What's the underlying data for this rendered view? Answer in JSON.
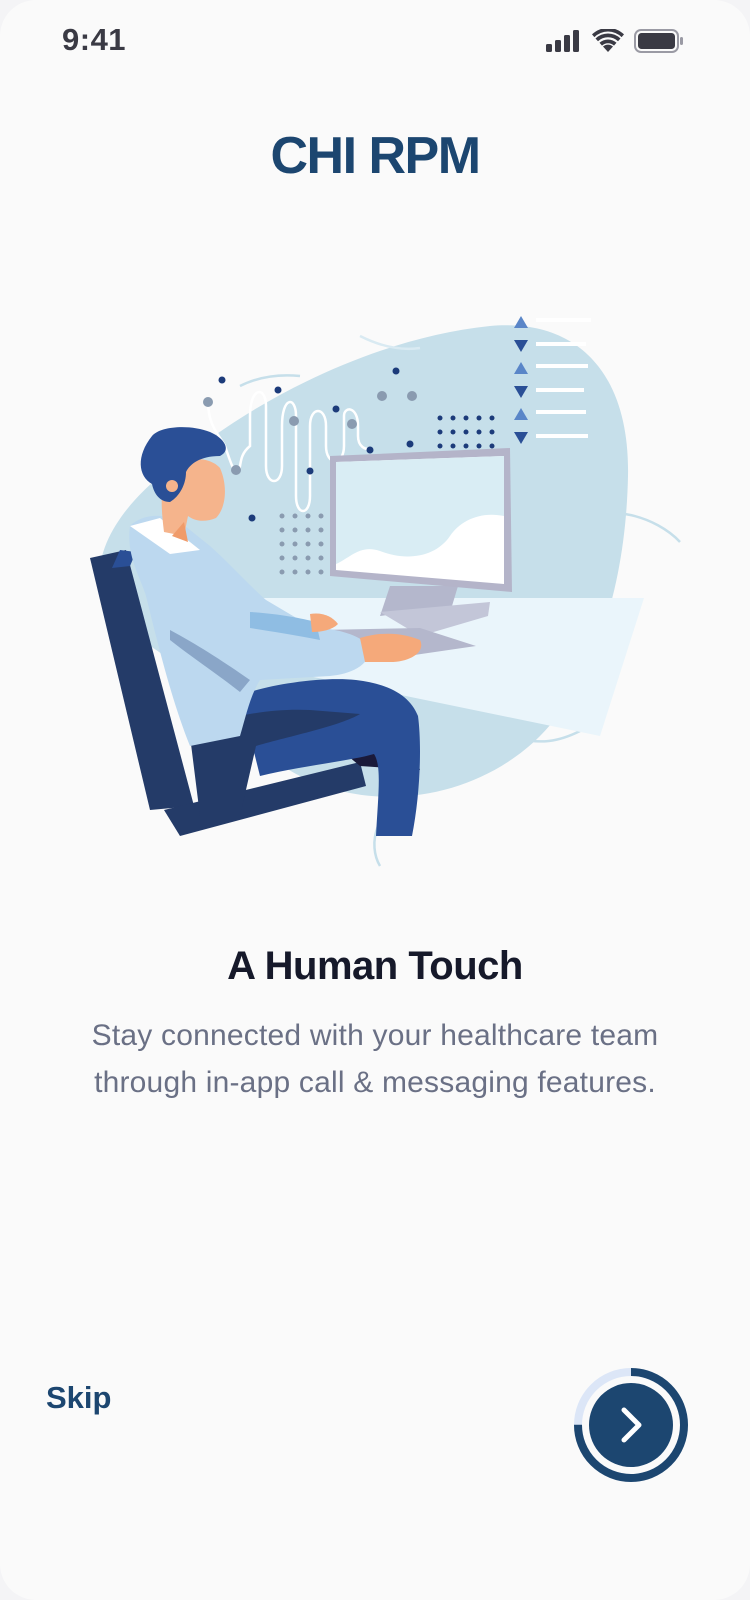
{
  "status_bar": {
    "time": "9:41",
    "icons": [
      "cellular-signal-icon",
      "wifi-icon",
      "battery-icon"
    ]
  },
  "app": {
    "title": "CHI RPM"
  },
  "onboarding": {
    "illustration": "person-at-computer-illustration",
    "heading": "A Human Touch",
    "description": "Stay connected with your healthcare team through in-app call & messaging features.",
    "progress": {
      "current_step": 3,
      "total_steps": 4
    }
  },
  "actions": {
    "skip_label": "Skip",
    "next_icon": "chevron-right-icon"
  },
  "colors": {
    "brand": "#1c4670",
    "heading": "#16192a",
    "body_text": "#6a7085",
    "progress_track": "#dce6f7",
    "background": "#fafafa"
  }
}
